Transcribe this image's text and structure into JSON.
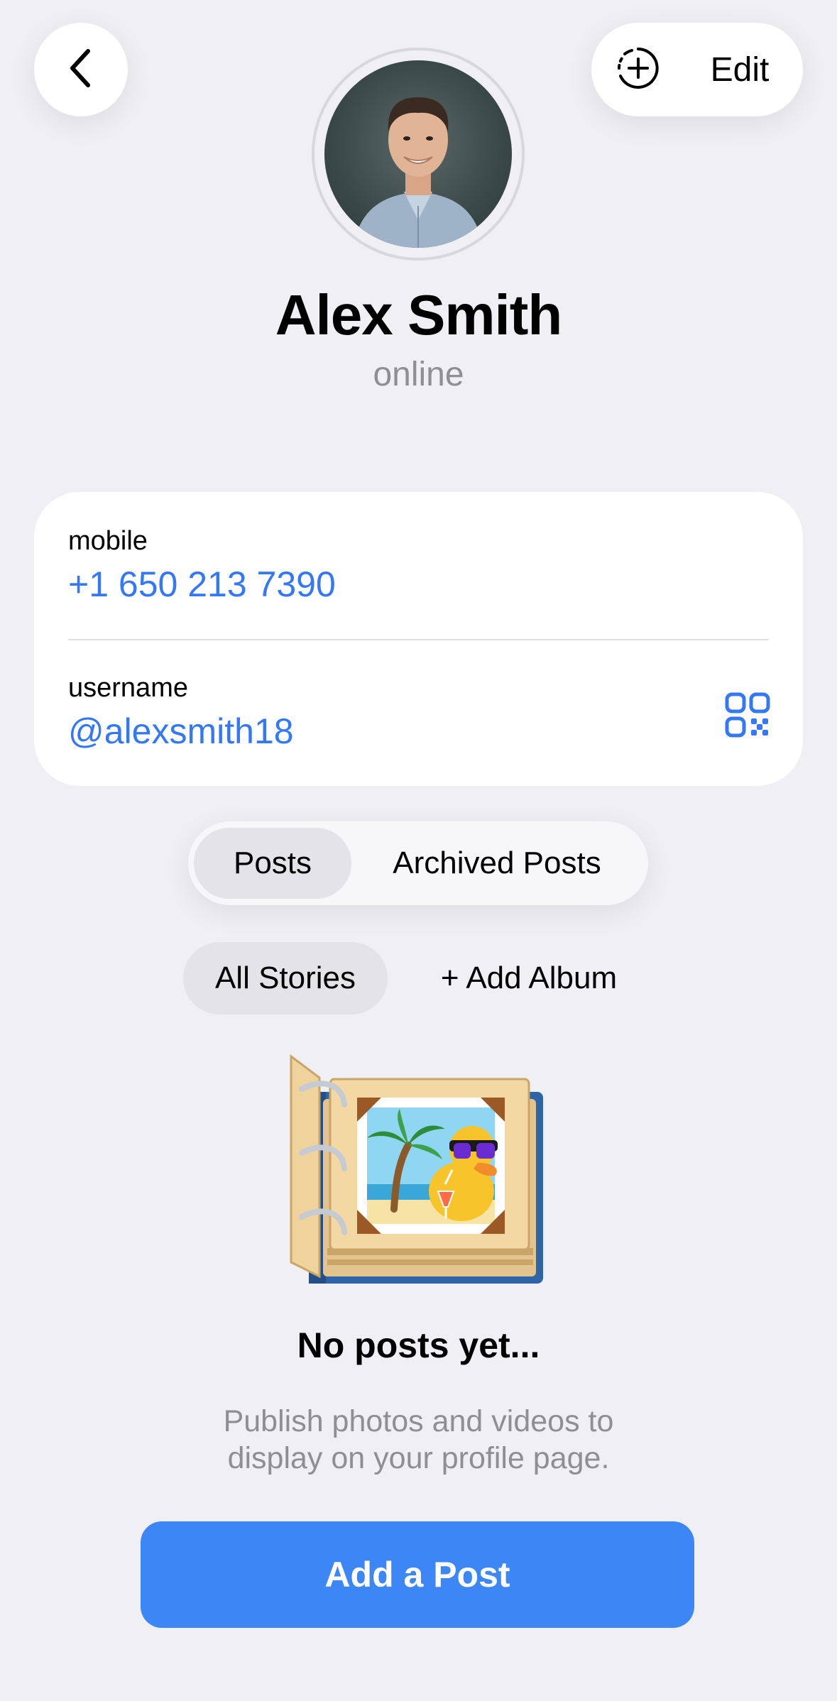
{
  "header": {
    "edit_label": "Edit"
  },
  "profile": {
    "name": "Alex Smith",
    "status": "online"
  },
  "info": {
    "mobile_label": "mobile",
    "mobile_value": "+1 650 213 7390",
    "username_label": "username",
    "username_value": "@alexsmith18"
  },
  "tabs": {
    "posts": "Posts",
    "archived": "Archived Posts"
  },
  "albums": {
    "all_stories": "All Stories",
    "add_album": "+ Add Album"
  },
  "empty": {
    "title": "No posts yet...",
    "desc_line1": "Publish photos and videos to",
    "desc_line2": "display on your profile page."
  },
  "cta": {
    "add_post": "Add a Post"
  },
  "colors": {
    "accent": "#3478f6",
    "button": "#3c87f5",
    "background": "#efeff4"
  },
  "icons": {
    "back": "chevron-left-icon",
    "add_story": "add-story-icon",
    "qr": "qr-code-icon"
  }
}
